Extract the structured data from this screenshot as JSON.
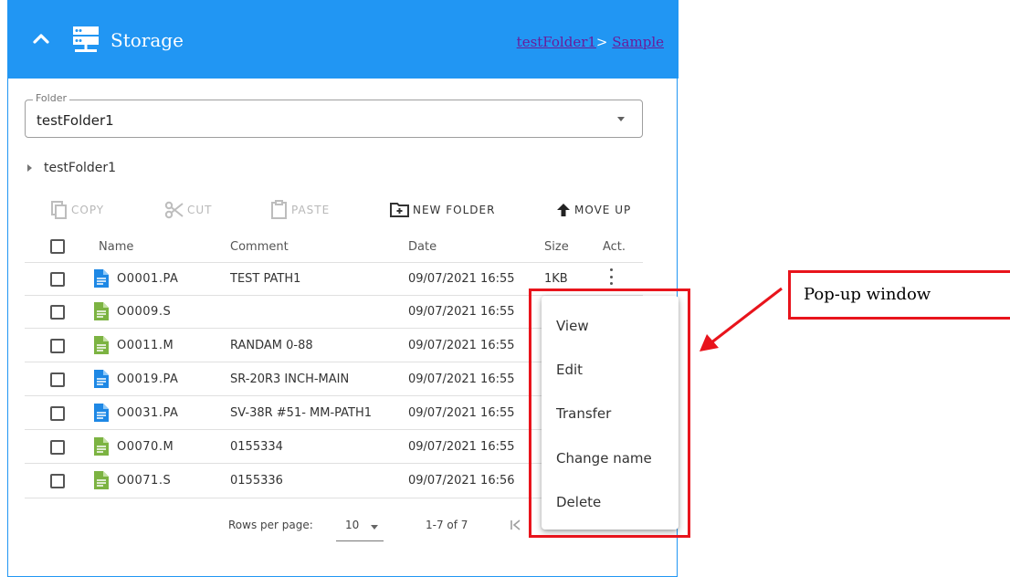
{
  "header": {
    "title": "Storage",
    "chevron_icon": "chevron-up-icon",
    "storage_icon": "server-icon"
  },
  "breadcrumb": {
    "items": [
      "testFolder1",
      "Sample"
    ],
    "separator": ">"
  },
  "folder_select": {
    "label": "Folder",
    "value": "testFolder1"
  },
  "tree": {
    "node_label": "testFolder1"
  },
  "toolbar": {
    "copy": "COPY",
    "cut": "CUT",
    "paste": "PASTE",
    "new_folder": "NEW FOLDER",
    "move_up": "MOVE UP"
  },
  "table": {
    "columns": [
      "Name",
      "Comment",
      "Date",
      "Size",
      "Act."
    ],
    "rows": [
      {
        "name": "O0001.PA",
        "comment": "TEST PATH1",
        "date": "09/07/2021 16:55",
        "size": "1KB",
        "icon": "file-blue-icon"
      },
      {
        "name": "O0009.S",
        "comment": "",
        "date": "09/07/2021 16:55",
        "size": "",
        "icon": "file-green-icon"
      },
      {
        "name": "O0011.M",
        "comment": "RANDAM 0-88",
        "date": "09/07/2021 16:55",
        "size": "",
        "icon": "file-green-icon"
      },
      {
        "name": "O0019.PA",
        "comment": "SR-20R3 INCH-MAIN",
        "date": "09/07/2021 16:55",
        "size": "",
        "icon": "file-blue-icon"
      },
      {
        "name": "O0031.PA",
        "comment": "SV-38R #51- MM-PATH1",
        "date": "09/07/2021 16:55",
        "size": "",
        "icon": "file-blue-icon"
      },
      {
        "name": "O0070.M",
        "comment": "0155334",
        "date": "09/07/2021 16:55",
        "size": "",
        "icon": "file-green-icon"
      },
      {
        "name": "O0071.S",
        "comment": "0155336",
        "date": "09/07/2021 16:56",
        "size": "",
        "icon": "file-green-icon"
      }
    ]
  },
  "pagination": {
    "rows_per_page_label": "Rows per page:",
    "rows_per_page": "10",
    "range": "1-7 of 7"
  },
  "popup_menu": {
    "items": [
      "View",
      "Edit",
      "Transfer",
      "Change name",
      "Delete"
    ]
  },
  "annotation": {
    "label": "Pop-up window"
  },
  "colors": {
    "header": "#2196f3",
    "file_blue": "#1e88e5",
    "file_green": "#7cb342",
    "annotation_red": "#e8141c"
  }
}
